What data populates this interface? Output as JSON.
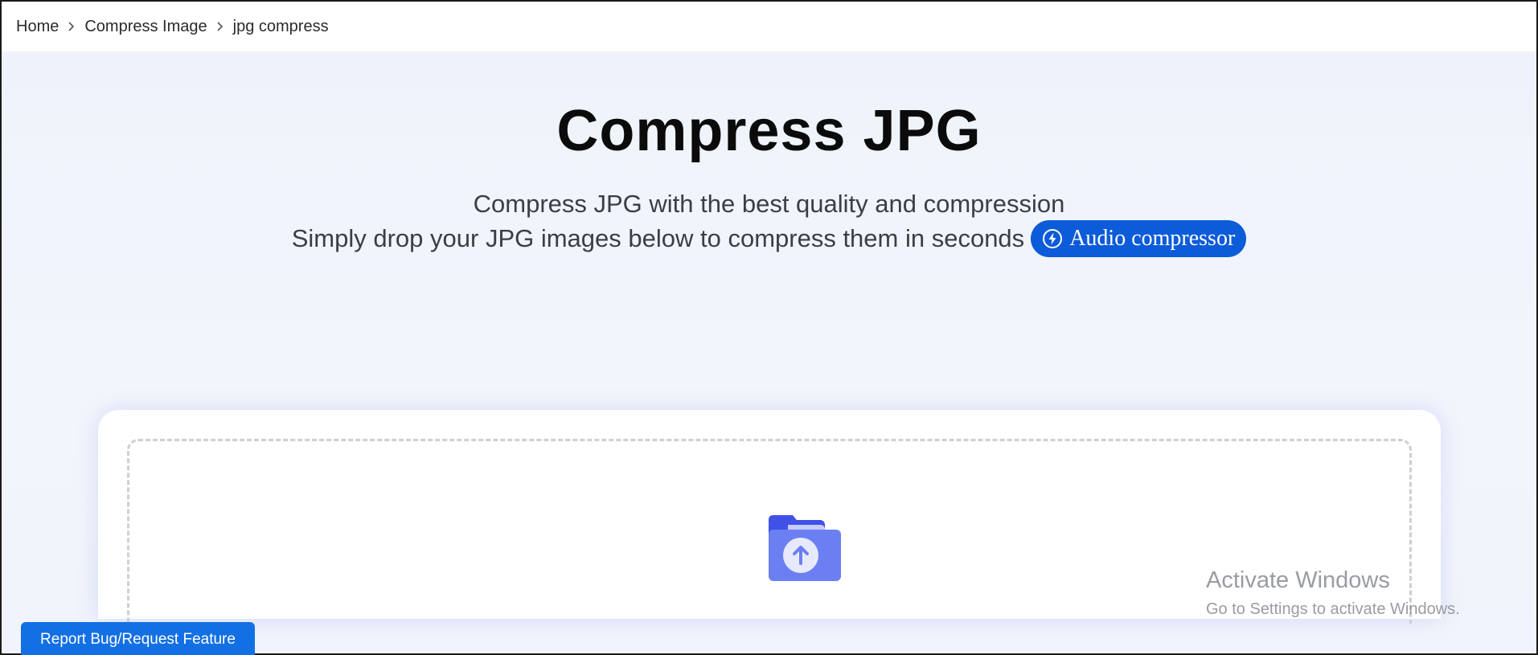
{
  "breadcrumb": {
    "items": [
      {
        "label": "Home"
      },
      {
        "label": "Compress Image"
      },
      {
        "label": "jpg compress"
      }
    ]
  },
  "hero": {
    "title": "Compress JPG",
    "subtitle_line1": "Compress JPG with the best quality and compression",
    "subtitle_line2": "Simply drop your JPG images below to compress them in seconds",
    "audio_button_label": "Audio compressor"
  },
  "watermark": {
    "title": "Activate Windows",
    "subtitle": "Go to Settings to activate Windows."
  },
  "report_button": {
    "label": "Report Bug/Request Feature"
  },
  "icons": {
    "breadcrumb_separator": "chevron-right-icon",
    "audio": "lightning-icon",
    "upload": "folder-upload-icon"
  },
  "colors": {
    "accent": "#0c5bd9",
    "report_button": "#1370e4",
    "folder_front": "#6c7ff2",
    "folder_back": "#3f51e6",
    "folder_tab_light": "#c8ccfa"
  }
}
